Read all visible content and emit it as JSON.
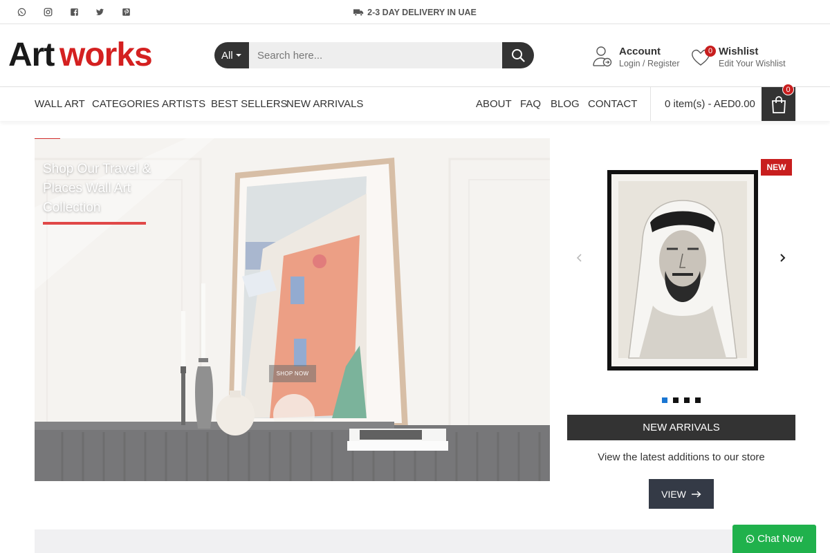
{
  "topbar": {
    "social": [
      "whatsapp-icon",
      "instagram-icon",
      "facebook-icon",
      "twitter-icon",
      "pinterest-icon"
    ],
    "delivery_text": "2-3 DAY DELIVERY IN UAE"
  },
  "header": {
    "logo_text_part1": "Art",
    "logo_text_part2": "works",
    "brand_colors": {
      "dark": "#1a1a1a",
      "red": "#d42020"
    },
    "search": {
      "category": "All",
      "placeholder": "Search here..."
    },
    "account": {
      "title": "Account",
      "subtitle": "Login / Register"
    },
    "wishlist": {
      "title": "Wishlist",
      "subtitle": "Edit Your Wishlist",
      "count": "0"
    }
  },
  "nav": {
    "left": [
      "WALL ART",
      "CATEGORIES",
      "ARTISTS",
      "BEST SELLERS",
      "NEW ARRIVALS"
    ],
    "right": [
      "ABOUT",
      "FAQ",
      "BLOG",
      "CONTACT"
    ],
    "cart_text": "0 item(s) - AED0.00",
    "cart_count": "0"
  },
  "hero": {
    "title": "Shop Our Travel & Places Wall Art Collection",
    "shop_label": "SHOP NOW"
  },
  "side": {
    "badge": "NEW",
    "slides": 4,
    "active_slide": 1,
    "bar_title": "NEW ARRIVALS",
    "description": "View the latest additions to our store",
    "button": "VIEW"
  },
  "chat": {
    "label": "Chat Now",
    "color": "#20b14c"
  }
}
